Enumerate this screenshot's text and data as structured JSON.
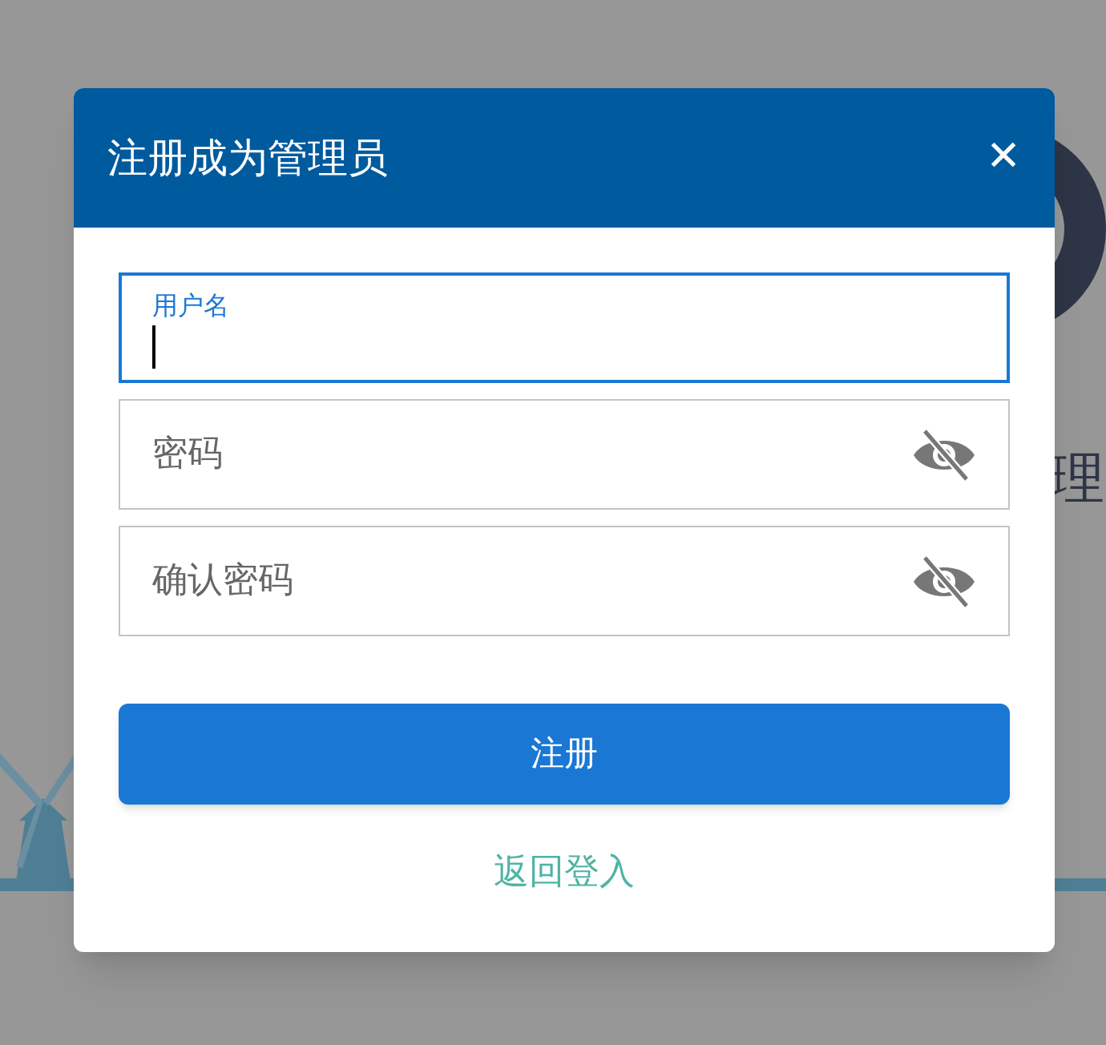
{
  "background": {
    "heading_fragment": "理"
  },
  "dialog": {
    "title": "注册成为管理员",
    "close": "✕",
    "fields": [
      {
        "kind": "text",
        "label": "用户名",
        "focused": true
      },
      {
        "kind": "password",
        "label": "密码",
        "focused": false
      },
      {
        "kind": "password",
        "label": "确认密码",
        "focused": false
      }
    ],
    "submit": "注册",
    "link": "返回登入"
  }
}
